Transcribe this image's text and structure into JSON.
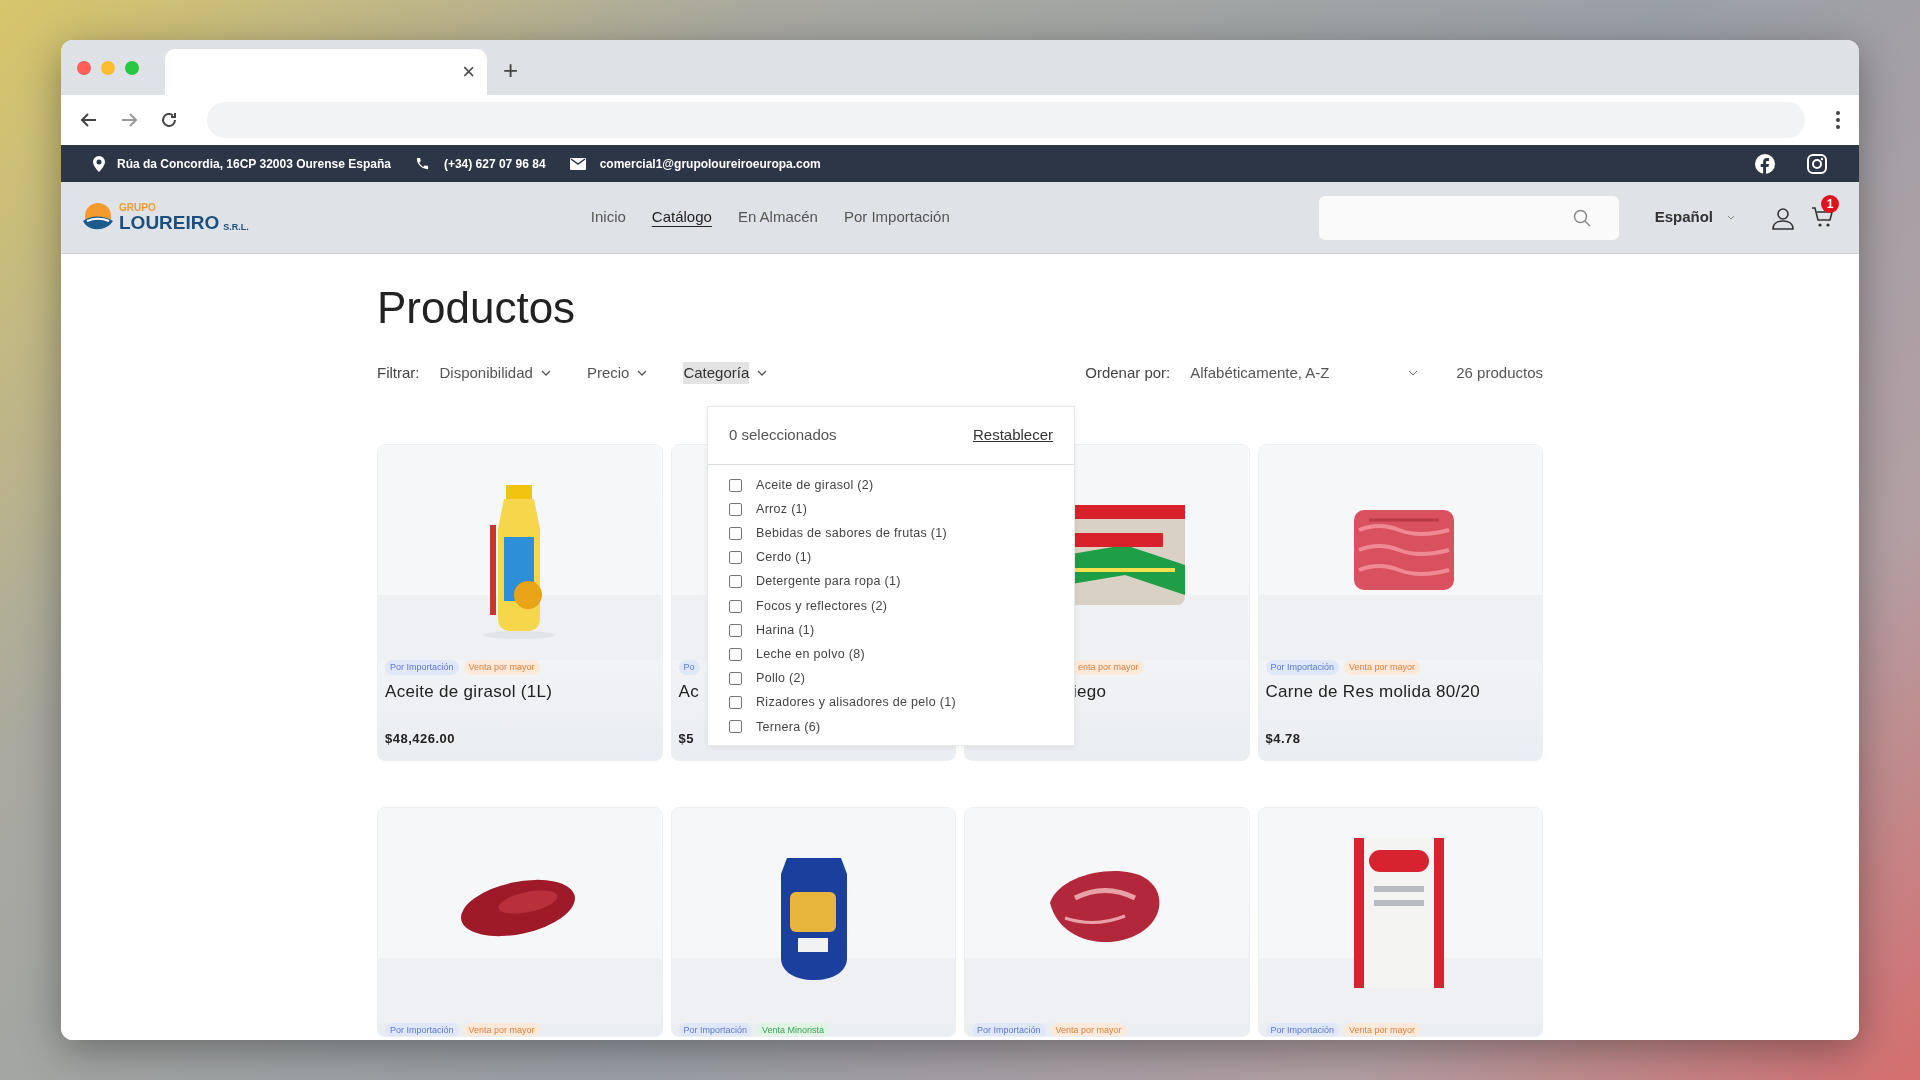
{
  "browser": {
    "tab_close": "×",
    "new_tab": "+"
  },
  "info_bar": {
    "address": "Rúa da Concordia, 16CP 32003 Ourense España",
    "phone": "(+34) 627 07 96 84",
    "email": "comercial1@grupoloureiroeuropa.com"
  },
  "header": {
    "logo": {
      "top": "GRUPO",
      "name": "LOUREIRO",
      "suffix": "S.R.L."
    },
    "nav": [
      {
        "label": "Inicio",
        "selected": false
      },
      {
        "label": "Catálogo",
        "selected": true
      },
      {
        "label": "En Almacén",
        "selected": false
      },
      {
        "label": "Por Importación",
        "selected": false
      }
    ],
    "language": "Español",
    "cart_count": "1"
  },
  "page": {
    "title": "Productos",
    "filter_label": "Filtrar:",
    "filters": [
      {
        "label": "Disponibilidad",
        "open": false
      },
      {
        "label": "Precio",
        "open": false
      },
      {
        "label": "Categoría",
        "open": true
      }
    ],
    "sort_label": "Ordenar por:",
    "sort_value": "Alfabéticamente, A-Z",
    "count": "26 productos"
  },
  "category_dropdown": {
    "selected_count": "0 seleccionados",
    "reset": "Restablecer",
    "options": [
      {
        "label": "Aceite de girasol (2)",
        "checked": false
      },
      {
        "label": "Arroz (1)",
        "checked": false
      },
      {
        "label": "Bebidas de sabores de frutas (1)",
        "checked": false
      },
      {
        "label": "Cerdo (1)",
        "checked": false
      },
      {
        "label": "Detergente para ropa (1)",
        "checked": false
      },
      {
        "label": "Focos y reflectores (2)",
        "checked": false
      },
      {
        "label": "Harina (1)",
        "checked": false
      },
      {
        "label": "Leche en polvo (8)",
        "checked": false
      },
      {
        "label": "Pollo (2)",
        "checked": false
      },
      {
        "label": "Rizadores y alisadores de pelo (1)",
        "checked": false
      },
      {
        "label": "Ternera (6)",
        "checked": false
      }
    ]
  },
  "products": [
    {
      "tags": [
        {
          "label": "Por Importación",
          "kind": "import"
        },
        {
          "label": "Venta por mayor",
          "kind": "wholesale"
        }
      ],
      "title": "Aceite de girasol (1L)",
      "price": "$48,426.00",
      "hidden_left": false
    },
    {
      "tags": [
        {
          "label": "Po",
          "kind": "import"
        }
      ],
      "title": "Ac",
      "price": "$5",
      "hidden_left": false
    },
    {
      "tags": [
        {
          "label": "enta por mayor",
          "kind": "wholesale"
        }
      ],
      "title": "iego",
      "hidden_left": true
    },
    {
      "tags": [
        {
          "label": "Por Importación",
          "kind": "import"
        },
        {
          "label": "Venta por mayor",
          "kind": "wholesale"
        }
      ],
      "title": "Carne de Res molida 80/20",
      "price": "$4.78",
      "hidden_left": false
    },
    {
      "tags": [
        {
          "label": "Por Importación",
          "kind": "import"
        },
        {
          "label": "Venta por mayor",
          "kind": "wholesale"
        }
      ],
      "hidden_left": false
    },
    {
      "tags": [
        {
          "label": "Por Importación",
          "kind": "import"
        },
        {
          "label": "Venta Minorista",
          "kind": "retail"
        }
      ],
      "hidden_left": false
    },
    {
      "tags": [
        {
          "label": "Por Importación",
          "kind": "import"
        },
        {
          "label": "Venta por mayor",
          "kind": "wholesale"
        }
      ],
      "hidden_left": false
    },
    {
      "tags": [
        {
          "label": "Por Importación",
          "kind": "import"
        },
        {
          "label": "Venta por mayor",
          "kind": "wholesale"
        }
      ],
      "hidden_left": false
    }
  ]
}
